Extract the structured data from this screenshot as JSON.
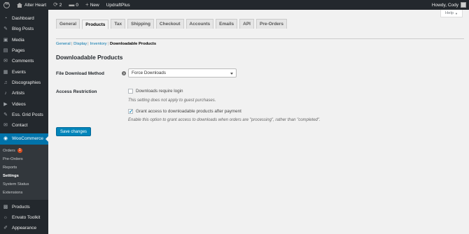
{
  "adminbar": {
    "site_name": "Alter Heart",
    "updates_count": "2",
    "comments_count": "0",
    "new_label": "New",
    "plugin_label": "UpdraftPlus",
    "howdy": "Howdy, Cody"
  },
  "sidebar": {
    "items_top": [
      {
        "label": "Dashboard",
        "icon": "dashboard-icon",
        "glyph": "◔"
      },
      {
        "label": "Blog Posts",
        "icon": "pin-icon",
        "glyph": "✎"
      },
      {
        "label": "Media",
        "icon": "media-icon",
        "glyph": "▣"
      },
      {
        "label": "Pages",
        "icon": "pages-icon",
        "glyph": "▤"
      },
      {
        "label": "Comments",
        "icon": "comments-icon",
        "glyph": "✉"
      },
      {
        "label": "Events",
        "icon": "events-icon",
        "glyph": "▦"
      },
      {
        "label": "Discographies",
        "icon": "discographies-icon",
        "glyph": "♫"
      },
      {
        "label": "Artists",
        "icon": "artists-icon",
        "glyph": "♪"
      },
      {
        "label": "Videos",
        "icon": "videos-icon",
        "glyph": "▶"
      },
      {
        "label": "Ess. Grid Posts",
        "icon": "grid-posts-icon",
        "glyph": "✎"
      },
      {
        "label": "Contact",
        "icon": "contact-icon",
        "glyph": "✉"
      }
    ],
    "woocommerce": {
      "label": "WooCommerce",
      "icon": "woocommerce-icon",
      "glyph": "◉"
    },
    "sub_items": [
      {
        "label": "Orders",
        "badge": "1"
      },
      {
        "label": "Pre-Orders"
      },
      {
        "label": "Reports"
      },
      {
        "label": "Settings"
      },
      {
        "label": "System Status"
      },
      {
        "label": "Extensions"
      }
    ],
    "items_bottom": [
      {
        "label": "Products",
        "icon": "products-icon",
        "glyph": "▩"
      },
      {
        "label": "Envato Toolkit",
        "icon": "envato-icon",
        "glyph": "☼"
      },
      {
        "label": "Appearance",
        "icon": "appearance-icon",
        "glyph": "✐"
      }
    ]
  },
  "help": {
    "label": "Help"
  },
  "tabs": [
    "General",
    "Products",
    "Tax",
    "Shipping",
    "Checkout",
    "Accounts",
    "Emails",
    "API",
    "Pre-Orders"
  ],
  "active_tab": "Products",
  "subsub": {
    "links": [
      "General",
      "Display",
      "Inventory"
    ],
    "current": "Downloadable Products"
  },
  "section": {
    "title": "Downloadable Products"
  },
  "fields": {
    "file_download_method": {
      "label": "File Download Method",
      "help": "?",
      "value": "Force Downloads"
    },
    "access_restriction": {
      "label": "Access Restriction",
      "checkbox1": {
        "label": "Downloads require login",
        "checked": false
      },
      "desc1": "This setting does not apply to guest purchases.",
      "checkbox2": {
        "label": "Grant access to downloadable products after payment",
        "checked": true
      },
      "desc2": "Enable this option to grant access to downloads when orders are \"processing\", rather than \"completed\"."
    }
  },
  "save_label": "Save changes",
  "colors": {
    "accent": "#0073aa",
    "adminbar": "#23282d",
    "button": "#0085ba",
    "badge": "#d54e21"
  }
}
